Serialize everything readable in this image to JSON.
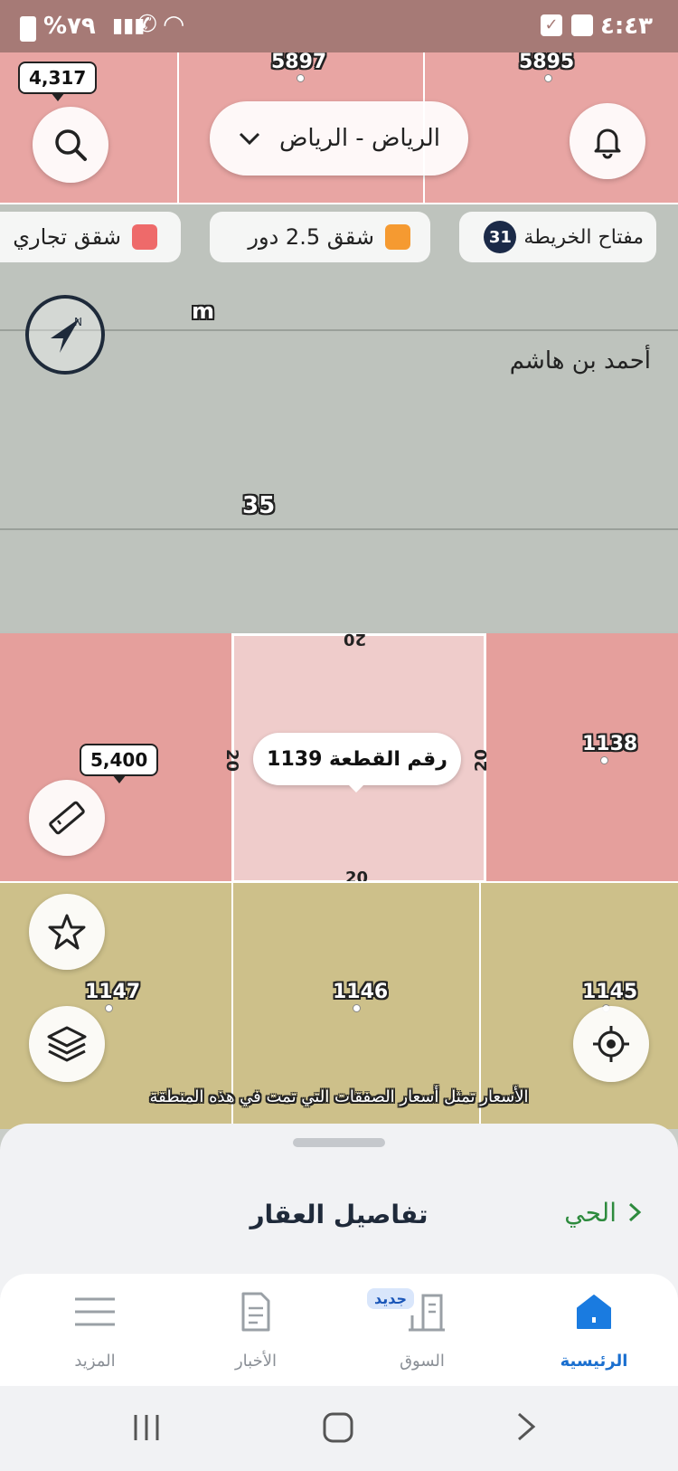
{
  "status_bar": {
    "time": "٤:٤٣",
    "battery": "%٧٩"
  },
  "header": {
    "location_selector": "الرياض - الرياض",
    "search_count_badge": "4,317"
  },
  "legend_chips": {
    "map_key_label": "مفتاح الخريطة",
    "map_key_count": "31",
    "apartments_25_label": "شقق 2.5 دور",
    "commercial_label": "شقق تجاري",
    "colors": {
      "orange": "#f59a31",
      "red": "#ee6a6a"
    }
  },
  "map": {
    "scale_unit": "m",
    "street_name": "أحمد بن هاشم",
    "street_width": "35",
    "parcels": {
      "p5897": "5897",
      "p5895": "5895",
      "p1138": "1138",
      "p1147": "1147",
      "p1146": "1146",
      "p1145": "1145"
    },
    "selected_parcel": {
      "label": "رقم القطعة 1139",
      "dim_top": "20",
      "dim_bottom": "20",
      "dim_left": "20",
      "dim_right": "20"
    },
    "price_tag_measure": "5,400",
    "disclaimer": "الأسعار تمثل أسعار الصفقات التي تمت في هذه المنطقة"
  },
  "sheet": {
    "title": "تفاصيل العقار",
    "district_link": "الحي"
  },
  "bottom_nav": {
    "home": "الرئيسية",
    "market": "السوق",
    "market_badge": "جديد",
    "news": "الأخبار",
    "more": "المزيد"
  }
}
